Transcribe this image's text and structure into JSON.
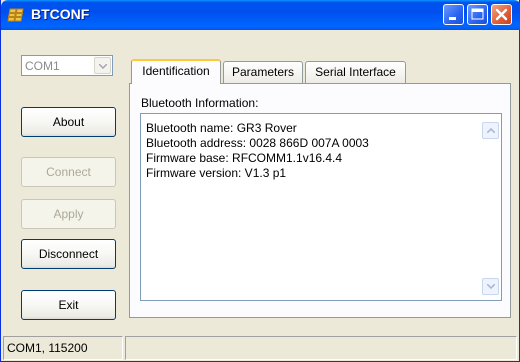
{
  "window": {
    "title": "BTCONF",
    "app_icon": "bluetooth-app-icon",
    "controls": [
      "minimize-icon",
      "maximize-icon",
      "close-icon"
    ],
    "accent_color": "#0055ea"
  },
  "port_select": {
    "value": "COM1",
    "disabled": true
  },
  "buttons": {
    "about": "About",
    "connect": "Connect",
    "apply": "Apply",
    "disconnect": "Disconnect",
    "exit": "Exit"
  },
  "tabs": [
    {
      "label": "Identification",
      "active": true
    },
    {
      "label": "Parameters",
      "active": false
    },
    {
      "label": "Serial Interface",
      "active": false
    }
  ],
  "identification": {
    "group_label": "Bluetooth Information:",
    "lines": [
      "Bluetooth name: GR3 Rover",
      "Bluetooth address: 0028 866D 007A 0003",
      "Firmware base: RFCOMM1.1v16.4.4",
      "Firmware version: V1.3 p1"
    ]
  },
  "status": {
    "connection": "COM1, 115200",
    "message": ""
  }
}
